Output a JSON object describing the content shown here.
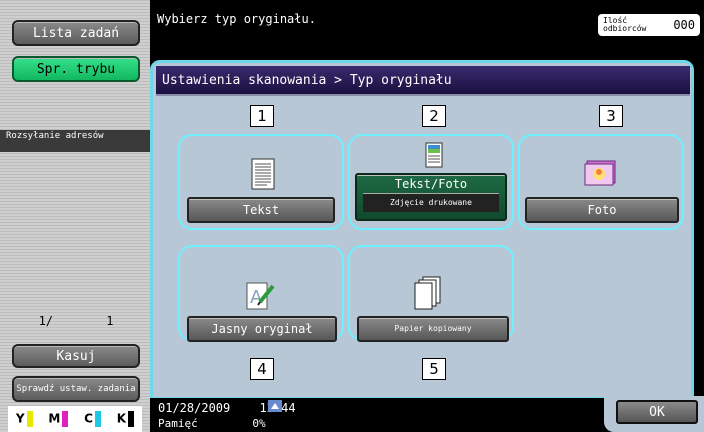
{
  "sidebar": {
    "job_list_label": "Lista zadań",
    "mode_check_label": "Spr. trybu",
    "broadcast_label": "Rozsyłanie adresów",
    "page_current": "1/",
    "page_total": "1",
    "delete_label": "Kasuj",
    "check_job_label": "Sprawdź ustaw. zadania",
    "toner": [
      {
        "label": "Y",
        "color": "#e8e800"
      },
      {
        "label": "M",
        "color": "#e020c0"
      },
      {
        "label": "C",
        "color": "#20c8e8"
      },
      {
        "label": "K",
        "color": "#000000"
      }
    ]
  },
  "header": {
    "message": "Wybierz typ oryginału.",
    "recipients_label": "Ilość odbiorców",
    "recipients_count": "000"
  },
  "panel": {
    "breadcrumb": "Ustawienia skanowania > Typ oryginału",
    "options": [
      {
        "number": "1",
        "label": "Tekst",
        "icon": "text-document-icon"
      },
      {
        "number": "2",
        "label": "Tekst/Foto",
        "sublabel": "Zdjęcie drukowane",
        "icon": "text-photo-icon",
        "selected": true
      },
      {
        "number": "3",
        "label": "Foto",
        "icon": "photo-icon"
      },
      {
        "number": "4",
        "label": "Jasny oryginał",
        "icon": "light-original-icon"
      },
      {
        "number": "5",
        "label": "Papier kopiowany",
        "icon": "copied-paper-icon"
      }
    ]
  },
  "footer": {
    "date": "01/28/2009",
    "time": "12:44",
    "memory_label": "Pamięć",
    "memory_value": "0%",
    "ok_label": "OK"
  },
  "colors": {
    "accent_cyan": "#6ff0ff",
    "selected_green": "#1e6a44",
    "mode_green": "#12b860",
    "panel_bg": "#b7c7d6"
  }
}
